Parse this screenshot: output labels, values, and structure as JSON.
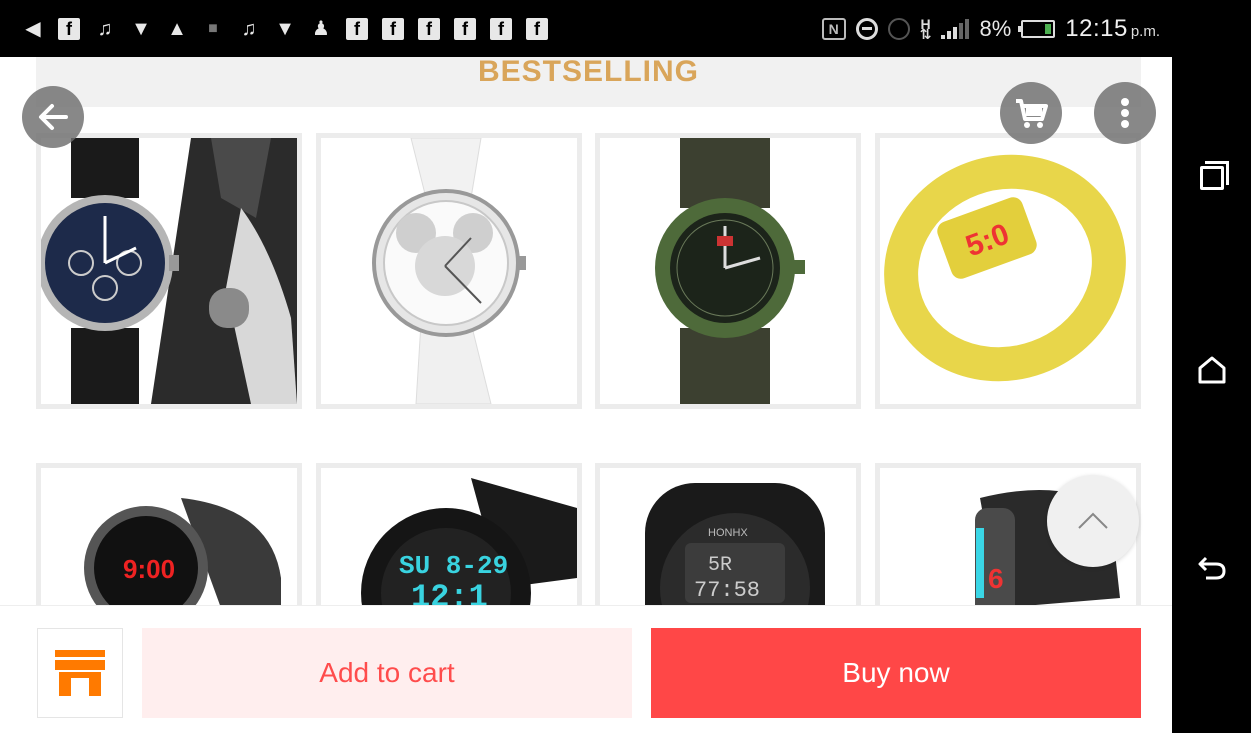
{
  "status_bar": {
    "battery_percent": "8%",
    "time": "12:15",
    "ampm": "p.m.",
    "left_icons": [
      "chat-plus-icon",
      "facebook-icon",
      "music-icon",
      "shield-icon",
      "warning-icon",
      "camera-icon",
      "music-icon",
      "shield-icon",
      "add-user-icon",
      "facebook-icon",
      "facebook-icon",
      "facebook-icon",
      "facebook-icon",
      "facebook-icon",
      "facebook-icon"
    ]
  },
  "section": {
    "title": "BESTSELLING"
  },
  "products": [
    {
      "name": "product-1",
      "icon": "analog-leather-watch"
    },
    {
      "name": "product-2",
      "icon": "mickey-silver-watch"
    },
    {
      "name": "product-3",
      "icon": "military-green-watch"
    },
    {
      "name": "product-4",
      "icon": "yellow-led-bracelet"
    },
    {
      "name": "product-5",
      "icon": "black-led-touch-watch",
      "display": "9:00"
    },
    {
      "name": "product-6",
      "icon": "black-digital-sport-watch",
      "display": "SU 8-29"
    },
    {
      "name": "product-7",
      "icon": "honhx-digital-watch",
      "brand": "HONHX"
    },
    {
      "name": "product-8",
      "icon": "gray-led-band"
    }
  ],
  "bottom_bar": {
    "add_to_cart": "Add to cart",
    "buy_now": "Buy now"
  },
  "colors": {
    "accent_red": "#ff4747",
    "accent_pink": "#ffeeee",
    "title_gold": "#d9a55a",
    "store_orange": "#ff7a00"
  }
}
